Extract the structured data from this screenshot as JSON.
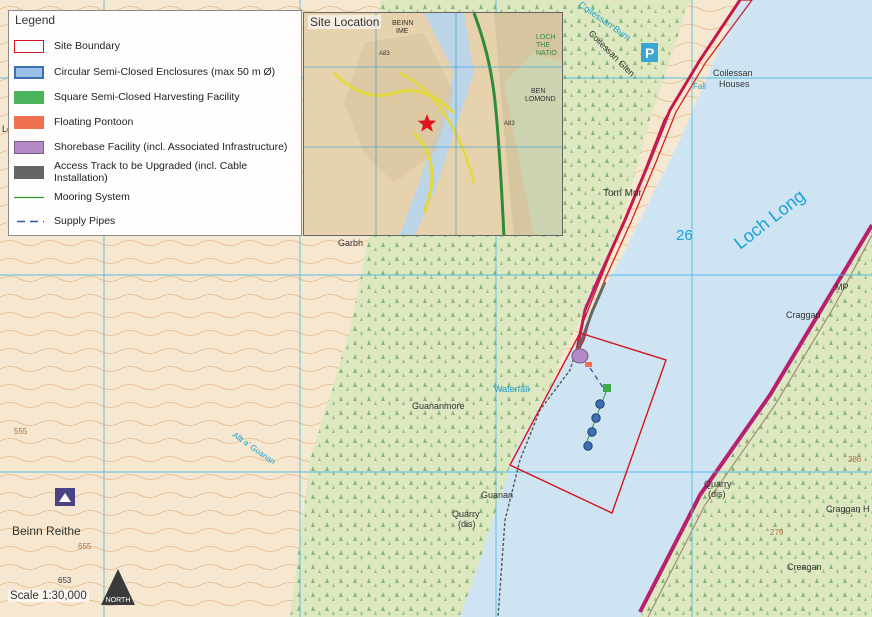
{
  "legend": {
    "title": "Legend",
    "items": [
      {
        "label": "Site Boundary",
        "icon": "site-boundary-swatch"
      },
      {
        "label": "Circular Semi-Closed Enclosures (max 50 m Ø)",
        "icon": "enclosure-swatch"
      },
      {
        "label": "Square Semi-Closed Harvesting Facility",
        "icon": "harvest-swatch"
      },
      {
        "label": "Floating Pontoon",
        "icon": "pontoon-swatch"
      },
      {
        "label": "Shorebase Facility (incl. Associated Infrastructure)",
        "icon": "shorebase-swatch"
      },
      {
        "label": "Access Track to be Upgraded (incl. Cable Installation)",
        "icon": "track-swatch"
      },
      {
        "label": "Mooring System",
        "icon": "mooring-line"
      },
      {
        "label": "Supply Pipes",
        "icon": "supply-pipe-line"
      }
    ]
  },
  "inset": {
    "title": "Site Location",
    "labels": [
      "BEINN",
      "IME",
      "A83",
      "LOCH",
      "THE",
      "NATIO",
      "BEN",
      "LOMOND",
      "A83"
    ]
  },
  "map": {
    "labels": {
      "loch_long": "Loch Long",
      "grid_26": "26",
      "tom_mor": "Tom Mor",
      "coilessan_houses": "Coilessan\nHouses",
      "coilessan_glen": "Coilessan Glen",
      "coilessan_burn": "Coilessan Burn",
      "garbh": "Garbh",
      "guananmore": "Guananmore",
      "waterfall": "Waterfall",
      "guanan": "Guanan",
      "quarry_left": "Quarry\n(dis)",
      "quarry_right": "Quarry\n(dis)",
      "craggan": "Craggan",
      "craggan_h": "Craggan H",
      "creagan": "Creagan",
      "beinn_reithe": "Beinn Reithe",
      "allt_a_guanan": "Allt a' Guanan",
      "mp": "MP",
      "parking": "P",
      "fall": "Fall",
      "h653": "653",
      "h655": "655",
      "h555": "555",
      "h286": "286",
      "h279": "279",
      "le": "Le"
    },
    "colors": {
      "water": "#cfe4f2",
      "land": "#f6e9d4",
      "forest": "#dfe8c4",
      "site_boundary": "#d4141c",
      "enclosure": "#3d6fb3",
      "harvest": "#3fab4d",
      "pontoon": "#f0704f",
      "shorebase": "#b38ac6",
      "track": "#666666",
      "mooring": "#2c9b2c",
      "supply_pipe": "#2d58a6",
      "grid": "#46b8e3"
    }
  },
  "scale": "Scale 1:30,000",
  "north": "NORTH"
}
